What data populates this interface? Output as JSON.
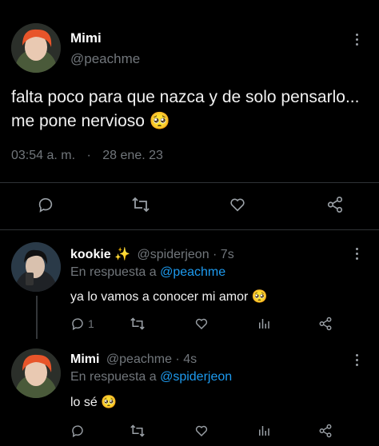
{
  "main_tweet": {
    "display_name": "Mimi",
    "handle": "@peachme",
    "text_line1": "falta poco para que nazca y de solo pensarlo...",
    "text_line2": "me pone nervioso",
    "emoji": "🥺",
    "time": "03:54 a. m.",
    "separator": "·",
    "date": "28 ene. 23"
  },
  "reply1": {
    "display_name": "kookie ✨",
    "handle": "@spiderjeon · 7s",
    "reply_prefix": "En respuesta a",
    "reply_to": "@peachme",
    "text": "ya lo vamos a conocer mi amor",
    "emoji": "🥺",
    "reply_count": "1"
  },
  "reply2": {
    "display_name": "Mimi",
    "handle": "@peachme · 4s",
    "reply_prefix": "En respuesta a",
    "reply_to": "@spiderjeon",
    "text": "lo sé",
    "emoji": "🥺"
  },
  "icons": [
    "reply-icon",
    "retweet-icon",
    "like-icon",
    "share-icon",
    "views-icon",
    "more-icon"
  ],
  "colors": {
    "background": "#000000",
    "text": "#e7e9ea",
    "muted": "#71767b",
    "link": "#1d9bf0",
    "divider": "#2f3336"
  }
}
